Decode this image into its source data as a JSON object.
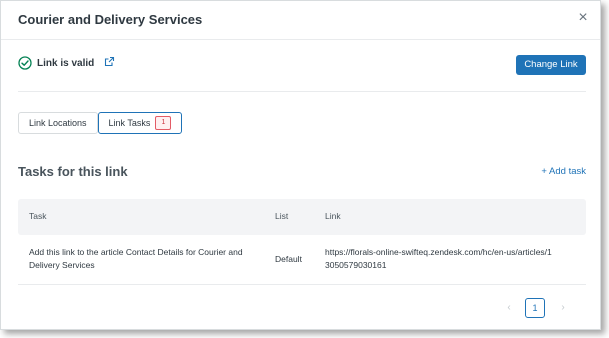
{
  "dialog": {
    "title": "Courier and Delivery Services",
    "close_icon": "close-icon"
  },
  "status": {
    "text": "Link is valid",
    "icon": "check-circle-icon",
    "color": "#038153",
    "external_icon": "external-link-icon"
  },
  "buttons": {
    "change_link": "Change Link",
    "add_task": "+ Add task"
  },
  "tabs": [
    {
      "label": "Link Locations",
      "active": false
    },
    {
      "label": "Link Tasks",
      "active": true,
      "count": "1"
    }
  ],
  "section": {
    "title": "Tasks for this link"
  },
  "table": {
    "headers": [
      "Task",
      "List",
      "Link"
    ],
    "rows": [
      {
        "task": "Add this link to the article Contact Details for Courier and Delivery Services",
        "list": "Default",
        "link": "https://florals-online-swifteq.zendesk.com/hc/en-us/articles/13050579030161"
      }
    ]
  },
  "pagination": {
    "current": "1",
    "prev_icon": "chevron-left-icon",
    "next_icon": "chevron-right-icon"
  },
  "colors": {
    "accent": "#1f73b7",
    "badge": "#cc3340"
  }
}
